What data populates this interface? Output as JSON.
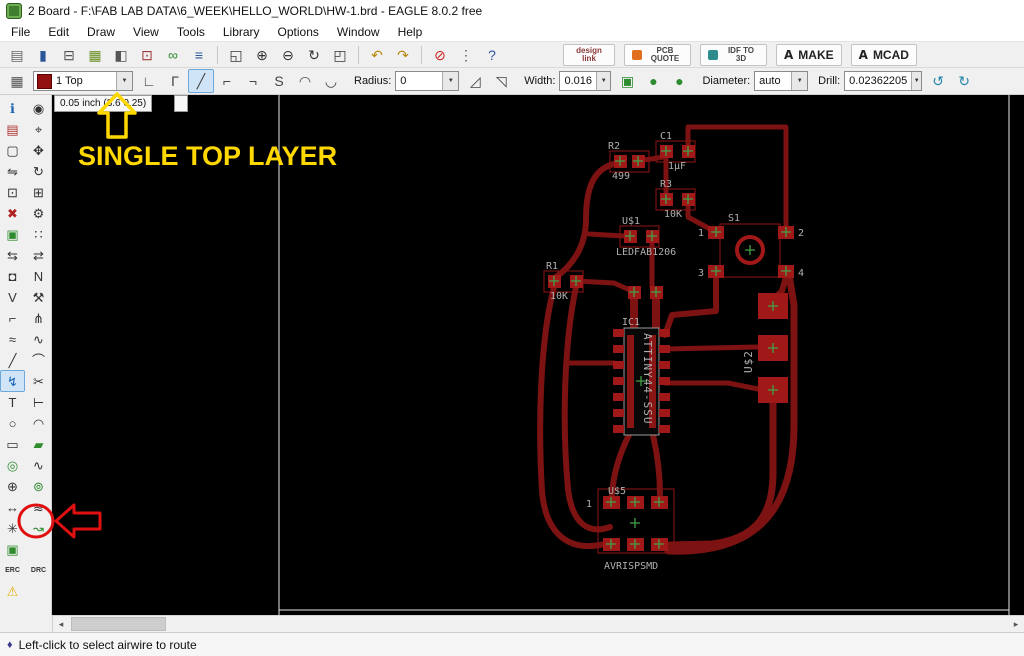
{
  "window": {
    "title": "2 Board - F:\\FAB LAB DATA\\6_WEEK\\HELLO_WORLD\\HW-1.brd - EAGLE 8.0.2 free"
  },
  "colors": {
    "yellow": "#ffd800",
    "red": "#e01010",
    "trace": "#7d1212",
    "pad": "#a01818",
    "swatch": "#941111",
    "cross": "#43a047",
    "label": "#b0b0b0"
  },
  "icons": {
    "dropdown_arrow": "▼",
    "scroll_left": "◂",
    "scroll_right": "▸"
  },
  "menu": {
    "items": [
      "File",
      "Edit",
      "Draw",
      "View",
      "Tools",
      "Library",
      "Options",
      "Window",
      "Help"
    ]
  },
  "toolbar_main": {
    "icon_groups": [
      [
        {
          "n": "open-icon",
          "g": "▤",
          "c": "#666"
        },
        {
          "n": "save-icon",
          "g": "▮",
          "c": "#2b579a"
        },
        {
          "n": "print-icon",
          "g": "⊟",
          "c": "#555"
        },
        {
          "n": "export-image-icon",
          "g": "▦",
          "c": "#6b8e23"
        },
        {
          "n": "cam-icon",
          "g": "◧",
          "c": "#555"
        },
        {
          "n": "schematic-icon",
          "g": "⊡",
          "c": "#a33a3a"
        },
        {
          "n": "design-link-icon",
          "g": "∞",
          "c": "#2e8b2e"
        },
        {
          "n": "layer-settings-icon",
          "g": "≡",
          "c": "#2b579a"
        }
      ],
      [
        {
          "n": "zoom-fit-icon",
          "g": "◱",
          "c": "#333"
        },
        {
          "n": "zoom-in-icon",
          "g": "⊕",
          "c": "#333"
        },
        {
          "n": "zoom-out-icon",
          "g": "⊖",
          "c": "#333"
        },
        {
          "n": "zoom-redraw-icon",
          "g": "↻",
          "c": "#333"
        },
        {
          "n": "zoom-select-icon",
          "g": "◰",
          "c": "#333"
        }
      ],
      [
        {
          "n": "undo-icon",
          "g": "↶",
          "c": "#b8860b"
        },
        {
          "n": "redo-icon",
          "g": "↷",
          "c": "#b8860b"
        }
      ],
      [
        {
          "n": "stop-icon",
          "g": "⊘",
          "c": "#cc2222"
        },
        {
          "n": "run-script-icon",
          "g": "⋮",
          "c": "#555"
        },
        {
          "n": "help-icon",
          "g": "?",
          "c": "#2b579a"
        }
      ]
    ],
    "logo_glyph": "A",
    "buttons": [
      {
        "n": "design-link-button",
        "label": "design link",
        "text_color": "#8b3a3a"
      },
      {
        "n": "pcb-quote-button",
        "label": "PCB QUOTE",
        "icon_color": "#e07020"
      },
      {
        "n": "idf-to-3d-button",
        "label": "IDF TO 3D",
        "icon_color": "#2e8b8b"
      },
      {
        "n": "make-button",
        "label": "MAKE",
        "logo": true
      },
      {
        "n": "mcad-button",
        "label": "MCAD",
        "logo": true
      }
    ]
  },
  "toolbar2": {
    "left_icons": [
      {
        "n": "grid-icon",
        "g": "▦",
        "c": "#555"
      }
    ],
    "layer_value": "1 Top",
    "labels": {
      "radius": "Radius:",
      "width": "Width:",
      "diameter": "Diameter:",
      "drill": "Drill:"
    },
    "radius_value": "0",
    "width_value": "0.016",
    "diameter_value": "auto",
    "drill_value": "0.02362205",
    "bend_icons": [
      {
        "n": "bend-90-up-icon",
        "g": "∟"
      },
      {
        "n": "bend-45-up-icon",
        "g": "Γ"
      },
      {
        "n": "bend-diagonal-icon",
        "g": "╱",
        "active": true
      },
      {
        "n": "bend-45-down-icon",
        "g": "⌐"
      },
      {
        "n": "bend-90-down-icon",
        "g": "¬"
      },
      {
        "n": "bend-s-icon",
        "g": "S"
      },
      {
        "n": "bend-arc-up-icon",
        "g": "◠"
      },
      {
        "n": "bend-arc-down-icon",
        "g": "◡"
      }
    ],
    "miter_icons": [
      {
        "n": "miter-round-icon",
        "g": "◿"
      },
      {
        "n": "miter-straight-icon",
        "g": "◹"
      }
    ],
    "mode_icons": [
      {
        "n": "route-mode-icon",
        "g": "▣",
        "c": "#2e8b2e"
      },
      {
        "n": "follow-me-icon",
        "g": "●",
        "c": "#2e8b2e"
      },
      {
        "n": "follow-me-alt-icon",
        "g": "●",
        "c": "#2e8b2e"
      }
    ],
    "loop_icons": [
      {
        "n": "loop-left-icon",
        "g": "↺",
        "c": "#2185a8"
      },
      {
        "n": "loop-right-icon",
        "g": "↻",
        "c": "#2185a8"
      }
    ]
  },
  "coordbar": {
    "text": "0.05 inch (3.6 0.25)"
  },
  "palette": {
    "rows": [
      [
        {
          "n": "info-icon",
          "g": "ℹ",
          "c": "#1a62b0"
        },
        {
          "n": "show-icon",
          "g": "◉",
          "c": "#333"
        }
      ],
      [
        {
          "n": "display-layers-icon",
          "g": "▤",
          "c": "#b03030"
        },
        {
          "n": "mark-icon",
          "g": "⌖",
          "c": "#333"
        }
      ],
      [
        {
          "n": "group-icon",
          "g": "▢",
          "c": "#333"
        },
        {
          "n": "move-icon",
          "g": "✥",
          "c": "#333"
        }
      ],
      [
        {
          "n": "mirror-icon",
          "g": "⇋",
          "c": "#333"
        },
        {
          "n": "rotate-icon",
          "g": "↻",
          "c": "#333"
        }
      ],
      [
        {
          "n": "copy-icon",
          "g": "⊡",
          "c": "#333"
        },
        {
          "n": "paste-icon",
          "g": "⊞",
          "c": "#333"
        }
      ],
      [
        {
          "n": "delete-icon",
          "g": "✖",
          "c": "#b02020"
        },
        {
          "n": "change-icon",
          "g": "⚙",
          "c": "#333"
        }
      ],
      [
        {
          "n": "replace-icon",
          "g": "▣",
          "c": "#2e8b2e"
        },
        {
          "n": "array-icon",
          "g": "∷",
          "c": "#333"
        }
      ],
      [
        {
          "n": "pinswap-icon",
          "g": "⇆",
          "c": "#333"
        },
        {
          "n": "gateswap-icon",
          "g": "⇄",
          "c": "#333"
        }
      ],
      [
        {
          "n": "lock-icon",
          "g": "◘",
          "c": "#333"
        },
        {
          "n": "name-icon",
          "g": "N",
          "c": "#333"
        }
      ],
      [
        {
          "n": "value-icon",
          "g": "V",
          "c": "#333"
        },
        {
          "n": "smash-icon",
          "g": "⚒",
          "c": "#333"
        }
      ],
      [
        {
          "n": "miter-icon",
          "g": "⌐",
          "c": "#333"
        },
        {
          "n": "split-icon",
          "g": "⋔",
          "c": "#333"
        }
      ],
      [
        {
          "n": "optimize-icon",
          "g": "≈",
          "c": "#333"
        },
        {
          "n": "meander-icon",
          "g": "∿",
          "c": "#333"
        }
      ],
      [
        {
          "n": "wire-icon",
          "g": "╱",
          "c": "#333"
        },
        {
          "n": "curve-icon",
          "g": "⌒",
          "c": "#333"
        }
      ],
      [
        {
          "n": "route-icon",
          "g": "↯",
          "c": "#1a62b0",
          "active": true
        },
        {
          "n": "ripup-icon",
          "g": "✂",
          "c": "#333"
        }
      ],
      [
        {
          "n": "text-icon",
          "g": "T",
          "c": "#333"
        },
        {
          "n": "dimension-icon",
          "g": "⊢",
          "c": "#333"
        }
      ],
      [
        {
          "n": "circle-icon",
          "g": "○",
          "c": "#333"
        },
        {
          "n": "arc-icon",
          "g": "◠",
          "c": "#333"
        }
      ],
      [
        {
          "n": "rect-icon",
          "g": "▭",
          "c": "#333"
        },
        {
          "n": "polygon-icon",
          "g": "▰",
          "c": "#2e8b2e"
        }
      ],
      [
        {
          "n": "via-icon",
          "g": "◎",
          "c": "#2e8b2e"
        },
        {
          "n": "signal-icon",
          "g": "∿",
          "c": "#333"
        }
      ],
      [
        {
          "n": "hole-icon",
          "g": "⊕",
          "c": "#333"
        },
        {
          "n": "pad-icon",
          "g": "⊚",
          "c": "#2e8b2e"
        }
      ],
      [
        {
          "n": "width-icon",
          "g": "↔",
          "c": "#333"
        },
        {
          "n": "ratsnest-prep-icon",
          "g": "≋",
          "c": "#333"
        }
      ],
      [
        {
          "n": "ratsnest-icon",
          "g": "✳",
          "c": "#333"
        },
        {
          "n": "route-airwire-icon",
          "g": "↝",
          "c": "#2e8b2e"
        }
      ],
      [
        {
          "n": "autorouter-icon",
          "g": "▣",
          "c": "#2e8b2e"
        },
        null
      ],
      [
        {
          "n": "erc-button",
          "g": "ERC",
          "c": "#333",
          "small": true
        },
        {
          "n": "drc-button",
          "g": "DRC",
          "c": "#333",
          "small": true
        }
      ],
      [
        {
          "n": "errors-icon",
          "g": "⚠",
          "c": "#e8b007"
        },
        null
      ]
    ]
  },
  "pcb": {
    "components": {
      "r2": {
        "ref": "R2",
        "value": "499"
      },
      "c1": {
        "ref": "C1",
        "value": "1µF"
      },
      "r3": {
        "ref": "R3",
        "value": "10K"
      },
      "u1": {
        "ref": "U$1",
        "value": "LEDFAB1206"
      },
      "s1": {
        "ref": "S1",
        "pins": {
          "p1": "1",
          "p2": "2",
          "p3": "3",
          "p4": "4"
        }
      },
      "r1": {
        "ref": "R1",
        "value": "10K"
      },
      "ic1": {
        "ref": "IC1",
        "value": "ATTINY44-SSU"
      },
      "u2": {
        "ref": "U$2"
      },
      "u5": {
        "ref": "U$5",
        "value": "AVRISPSMD",
        "pin1": "1"
      }
    }
  },
  "annotations": {
    "top_layer": "SINGLE TOP LAYER"
  },
  "statusbar": {
    "icon": "♦",
    "text": "Left-click to select airwire to route"
  }
}
